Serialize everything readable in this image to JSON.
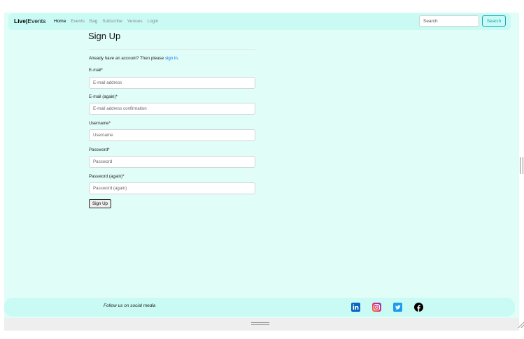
{
  "navbar": {
    "brand_bold": "Live",
    "brand_sep": "|",
    "brand_rest": "Events",
    "links": [
      {
        "label": "Home",
        "active": true
      },
      {
        "label": "Events",
        "active": false
      },
      {
        "label": "Bag",
        "active": false
      },
      {
        "label": "Subscribe",
        "active": false
      },
      {
        "label": "Venues",
        "active": false
      },
      {
        "label": "Login",
        "active": false
      }
    ],
    "search_placeholder": "Search",
    "search_button": "Search"
  },
  "signup": {
    "title": "Sign Up",
    "already_text": "Already have an account? Then please ",
    "signin_link": "sign in",
    "signin_suffix": ".",
    "fields": [
      {
        "label": "E-mail*",
        "placeholder": "E-mail address"
      },
      {
        "label": "E-mail (again)*",
        "placeholder": "E-mail address confirmation"
      },
      {
        "label": "Username*",
        "placeholder": "Username"
      },
      {
        "label": "Password*",
        "placeholder": "Password"
      },
      {
        "label": "Password (again)*",
        "placeholder": "Password (again)"
      }
    ],
    "submit_label": "Sign Up"
  },
  "footer": {
    "follow_text": "Follow us on social media",
    "social_icons": [
      "linkedin-icon",
      "instagram-icon",
      "twitter-icon",
      "facebook-icon"
    ]
  },
  "colors": {
    "page_bg": "#e1fdf8",
    "nav_bg": "#c9fbf4",
    "accent": "#17a2b8",
    "link": "#0d6efd"
  }
}
